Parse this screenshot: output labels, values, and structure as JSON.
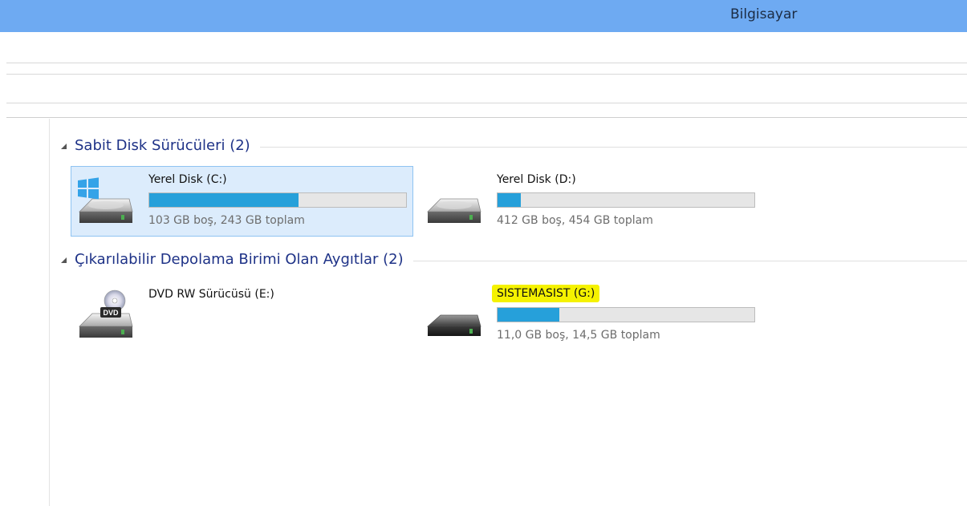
{
  "window": {
    "title": "Bilgisayar"
  },
  "groups": [
    {
      "label": "Sabit Disk Sürücüleri (2)",
      "items": [
        {
          "name": "Yerel Disk (C:)",
          "free_text": "103 GB boş, 243 GB toplam",
          "used_fraction": 0.58,
          "icon": "windows-system-drive-icon",
          "selected": true
        },
        {
          "name": "Yerel Disk (D:)",
          "free_text": "412 GB boş, 454 GB toplam",
          "used_fraction": 0.09,
          "icon": "hard-drive-icon",
          "selected": false
        }
      ]
    },
    {
      "label": "Çıkarılabilir Depolama Birimi Olan Aygıtlar (2)",
      "items": [
        {
          "name": "DVD RW Sürücüsü (E:)",
          "icon": "dvd-drive-icon",
          "selected": false
        },
        {
          "name": "SISTEMASIST (G:)",
          "free_text": "11,0 GB boş, 14,5 GB toplam",
          "used_fraction": 0.24,
          "icon": "usb-drive-icon",
          "selected": false,
          "highlighted": true
        }
      ]
    }
  ],
  "colors": {
    "titlebar": "#6eaaf2",
    "group_header_text": "#1e3287",
    "selection_bg": "#dcecfc",
    "selection_border": "#8fc3f2",
    "bar_fill": "#26a0da",
    "highlight": "#f5f200"
  }
}
